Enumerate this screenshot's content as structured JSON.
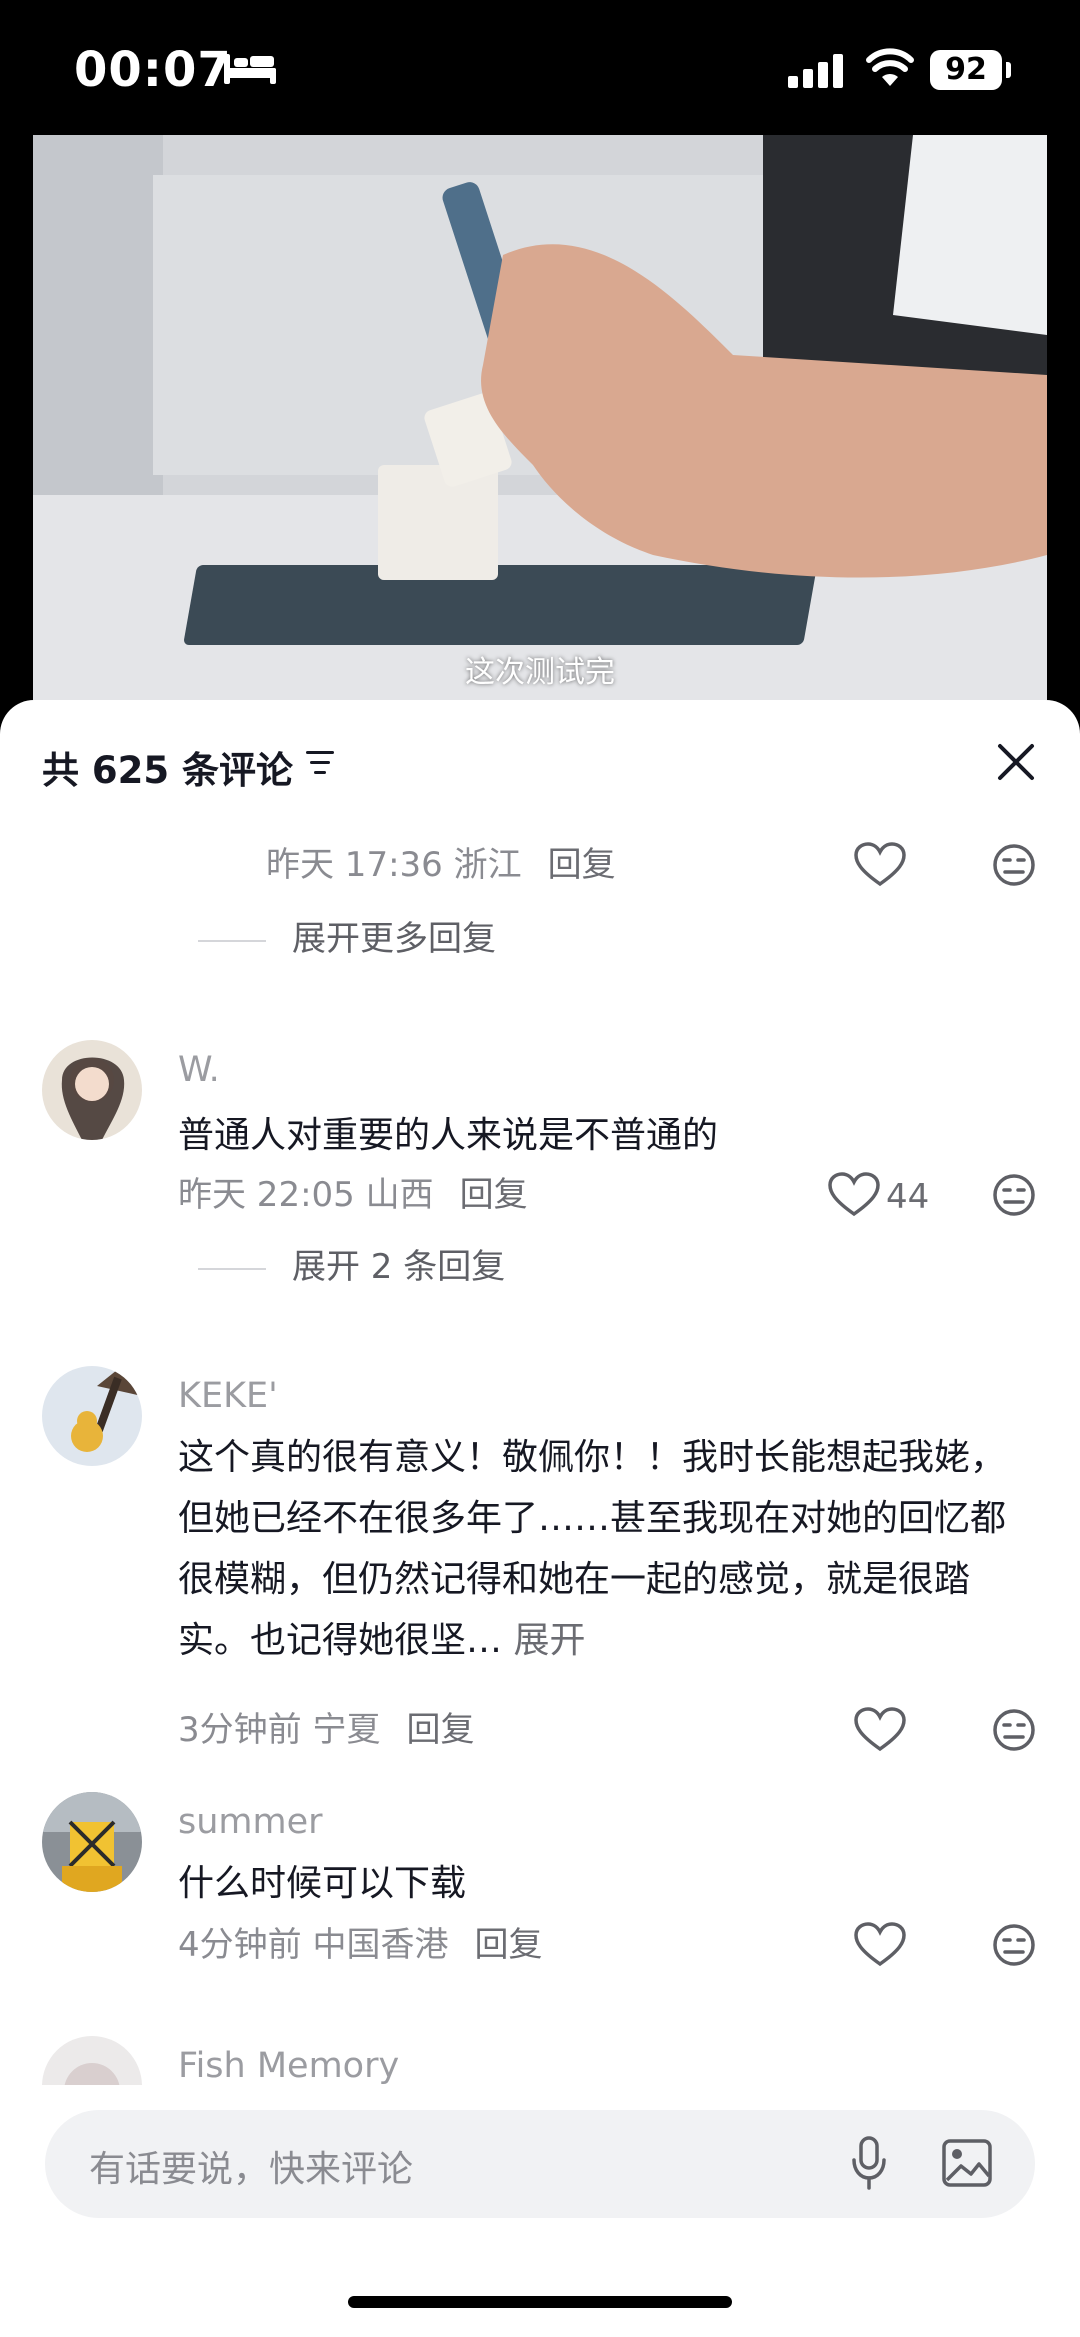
{
  "status_bar": {
    "time": "00:07",
    "battery": "92"
  },
  "video": {
    "subtitle": "这次测试完"
  },
  "comments_header": {
    "count_label": "共 625 条评论"
  },
  "input": {
    "placeholder": "有话要说，快来评论"
  },
  "comments": [
    {
      "meta": "昨天 17:36 浙江",
      "reply_label": "回复",
      "expand_label": "展开更多回复"
    },
    {
      "username": "W.",
      "text": "普通人对重要的人来说是不普通的",
      "meta": "昨天 22:05 山西",
      "reply_label": "回复",
      "likes": "44",
      "expand_label": "展开 2 条回复"
    },
    {
      "username": "KEKE'",
      "text": "这个真的很有意义！敬佩你！！我时长能想起我姥，但她已经不在很多年了……甚至我现在对她的回忆都很模糊，但仍然记得和她在一起的感觉，就是很踏实。也记得她很坚…",
      "more_label": "展开",
      "meta": "3分钟前 宁夏",
      "reply_label": "回复"
    },
    {
      "username": "summer",
      "text": "什么时候可以下载",
      "meta": "4分钟前 中国香港",
      "reply_label": "回复"
    },
    {
      "username": "Fish Memory"
    }
  ]
}
